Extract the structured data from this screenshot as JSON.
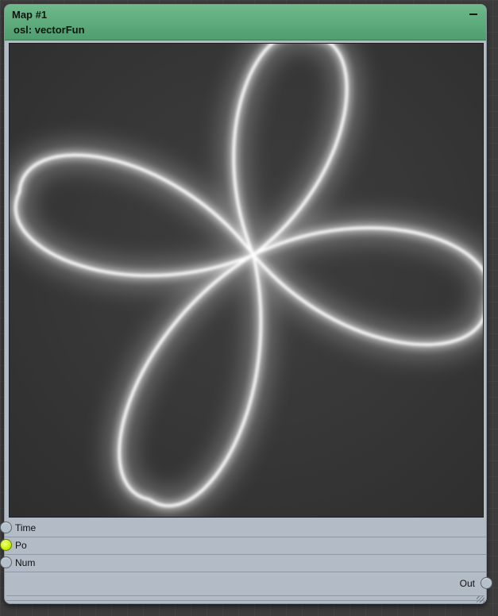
{
  "node": {
    "title": "Map #1",
    "subtitle": "osl: vectorFun",
    "collapse_icon": "minus-icon"
  },
  "preview": {
    "description_icon": "four-petal-rose-render",
    "background_color": "#3a3a3a",
    "glow_color": "#ffffff"
  },
  "inputs": [
    {
      "label": "Time",
      "connected": false
    },
    {
      "label": "Po",
      "connected": true,
      "color": "#c6f000"
    },
    {
      "label": "Num",
      "connected": false
    }
  ],
  "outputs": [
    {
      "label": "Out",
      "connected": false
    }
  ]
}
